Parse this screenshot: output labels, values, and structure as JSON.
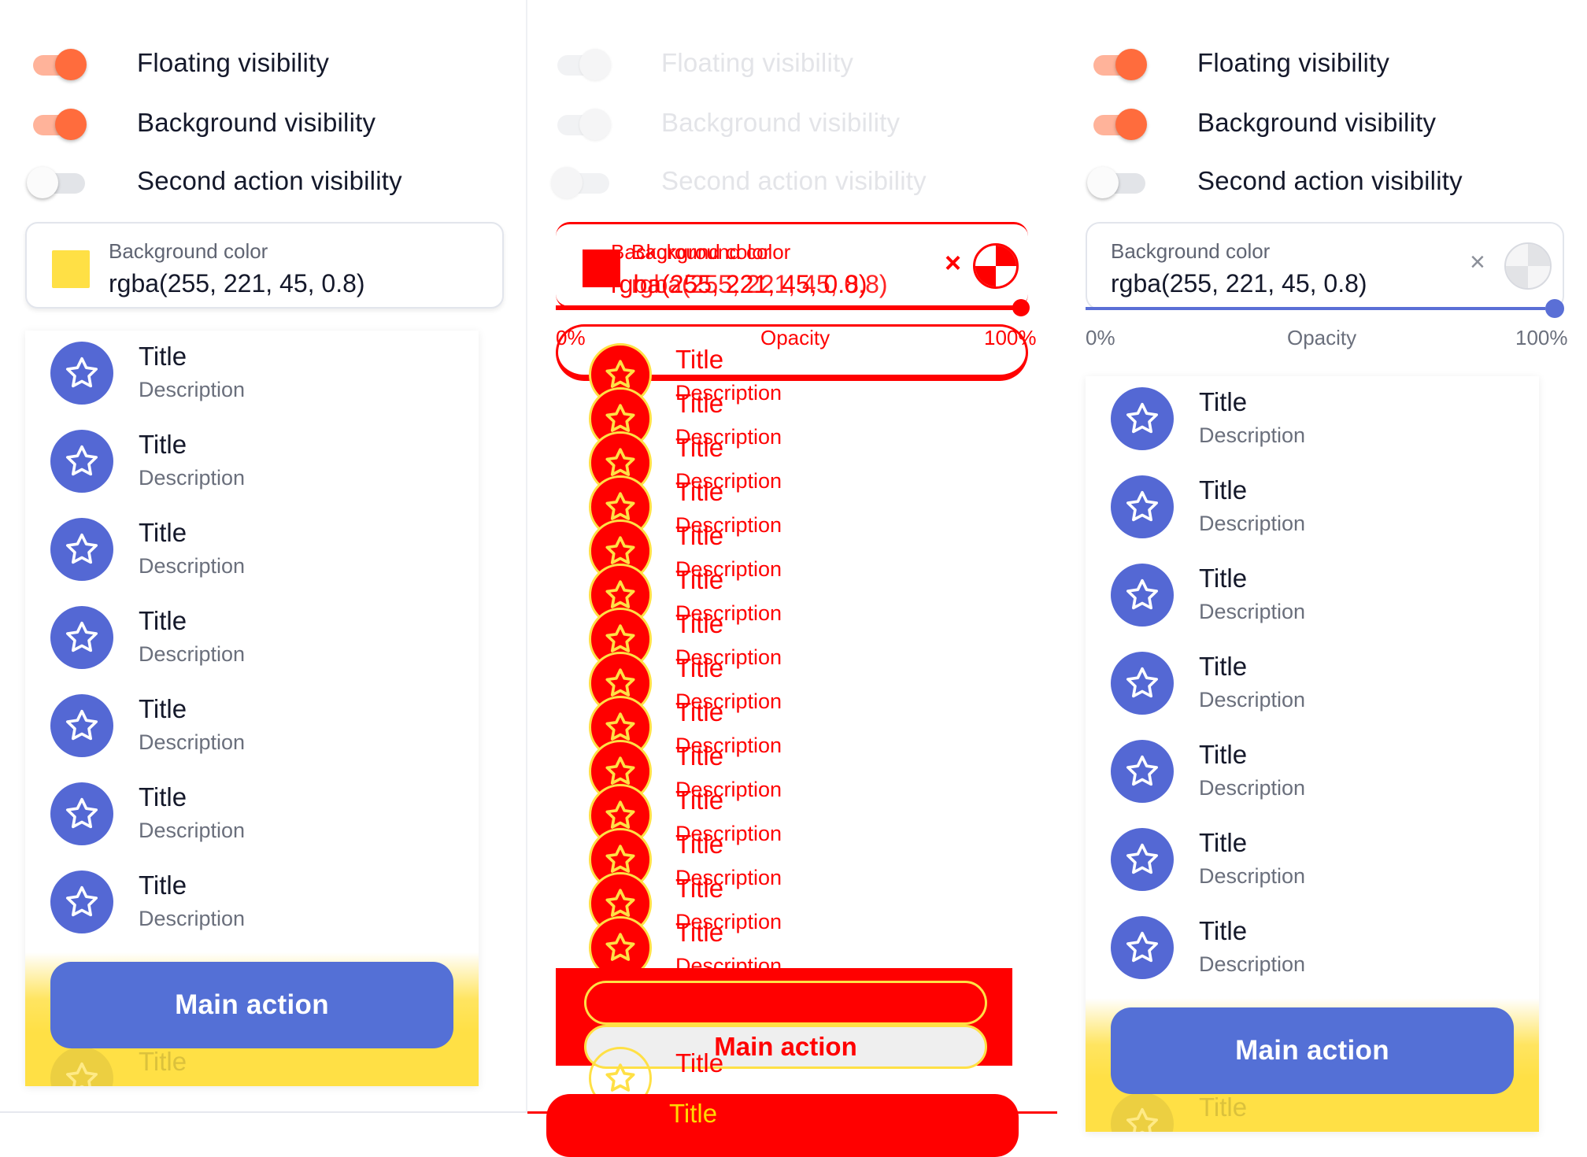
{
  "toggles": [
    {
      "label": "Floating visibility",
      "on": true
    },
    {
      "label": "Background visibility",
      "on": true
    },
    {
      "label": "Second action visibility",
      "on": false
    }
  ],
  "color_field": {
    "label": "Background color",
    "value": "rgba(255, 221, 45, 0.8)",
    "swatch": "#ffe045",
    "clear_icon": "×"
  },
  "opacity": {
    "min_label": "0%",
    "label": "Opacity",
    "max_label": "100%",
    "value_percent": 100
  },
  "list": {
    "items": [
      {
        "title": "Title",
        "description": "Description"
      },
      {
        "title": "Title",
        "description": "Description"
      },
      {
        "title": "Title",
        "description": "Description"
      },
      {
        "title": "Title",
        "description": "Description"
      },
      {
        "title": "Title",
        "description": "Description"
      },
      {
        "title": "Title",
        "description": "Description"
      },
      {
        "title": "Title",
        "description": "Description"
      }
    ],
    "peek_title": "Title",
    "item_icon": "star-icon"
  },
  "main_action": "Main action",
  "colors": {
    "accent": "#5470d6",
    "toggle_on": "#ff6c3d",
    "background_yellow": "#ffe045",
    "debug_red": "#ff0000"
  }
}
